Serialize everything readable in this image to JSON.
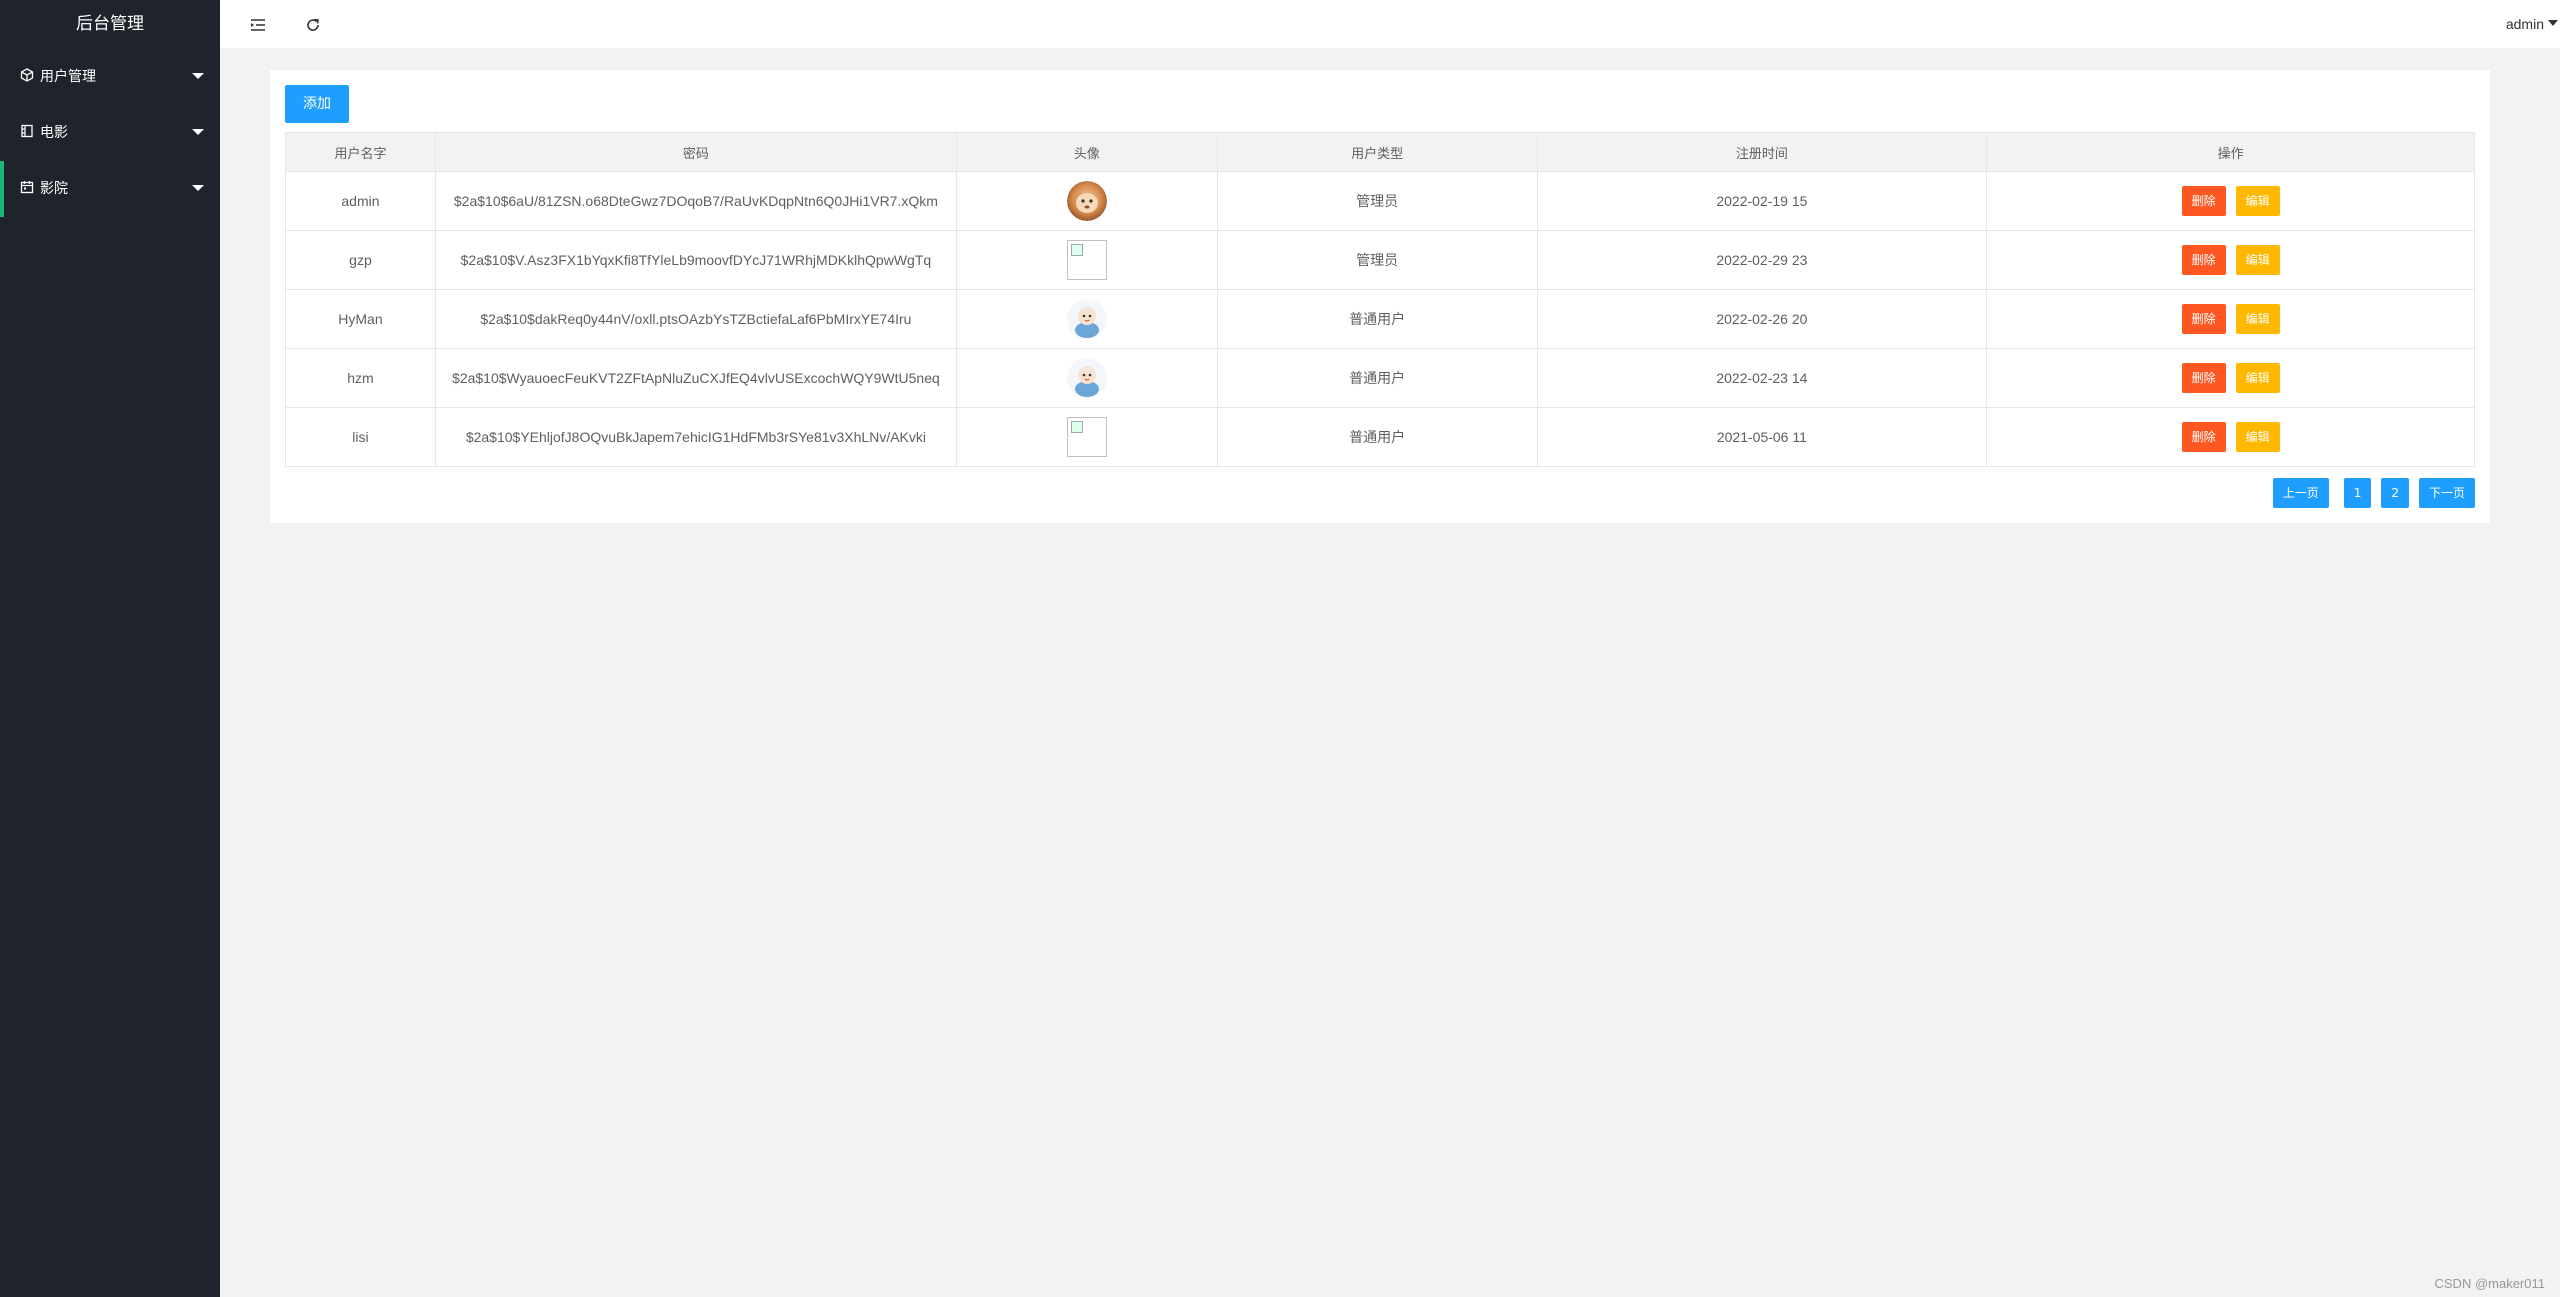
{
  "app": {
    "title": "后台管理"
  },
  "sidebar": {
    "items": [
      {
        "label": "用户管理",
        "icon": "cube-icon"
      },
      {
        "label": "电影",
        "icon": "film-icon"
      },
      {
        "label": "影院",
        "icon": "calendar-icon"
      }
    ]
  },
  "header": {
    "user": "admin"
  },
  "toolbar": {
    "add_label": "添加"
  },
  "table": {
    "columns": [
      "用户名字",
      "密码",
      "头像",
      "用户类型",
      "注册时间",
      "操作"
    ],
    "rows": [
      {
        "username": "admin",
        "password": "$2a$10$6aU/81ZSN.o68DteGwz7DOqoB7/RaUvKDqpNtn6Q0JHi1VR7.xQkm",
        "avatar": "photo-avatar",
        "type": "管理员",
        "registered": "2022-02-19 15"
      },
      {
        "username": "gzp",
        "password": "$2a$10$V.Asz3FX1bYqxKfi8TfYleLb9moovfDYcJ71WRhjMDKklhQpwWgTq",
        "avatar": "broken-image",
        "type": "管理员",
        "registered": "2022-02-29 23"
      },
      {
        "username": "HyMan",
        "password": "$2a$10$dakReq0y44nV/oxll.ptsOAzbYsTZBctiefaLaf6PbMIrxYE74Iru",
        "avatar": "cartoon-avatar",
        "type": "普通用户",
        "registered": "2022-02-26 20"
      },
      {
        "username": "hzm",
        "password": "$2a$10$WyauoecFeuKVT2ZFtApNluZuCXJfEQ4vlvUSExcochWQY9WtU5neq",
        "avatar": "cartoon-avatar",
        "type": "普通用户",
        "registered": "2022-02-23 14"
      },
      {
        "username": "lisi",
        "password": "$2a$10$YEhljofJ8OQvuBkJapem7ehicIG1HdFMb3rSYe81v3XhLNv/AKvki",
        "avatar": "broken-image",
        "type": "普通用户",
        "registered": "2021-05-06 11"
      }
    ],
    "delete_label": "删除",
    "edit_label": "编辑"
  },
  "pager": {
    "prev": "上一页",
    "pages": [
      "1",
      "2"
    ],
    "next": "下一页"
  },
  "watermark": "CSDN @maker011",
  "colors": {
    "primary": "#1e9fff",
    "danger": "#ff5722",
    "warning": "#ffb800",
    "sidebar": "#1f232c",
    "active": "#16b777"
  }
}
